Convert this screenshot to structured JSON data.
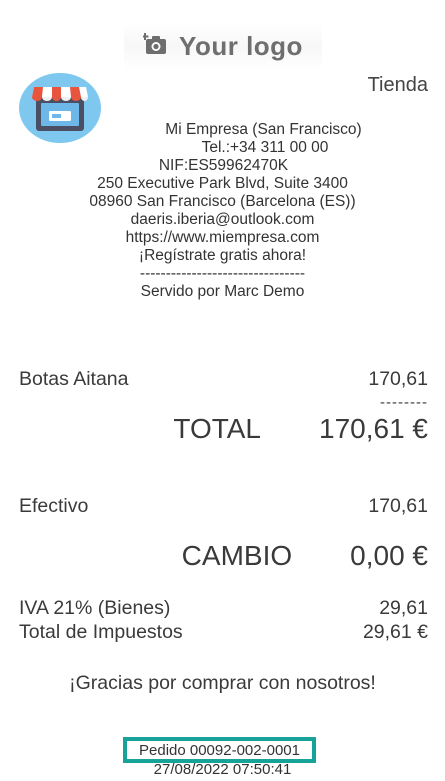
{
  "header": {
    "logo_text": "Your logo",
    "logo_icon": "camera-add-icon",
    "shop_icon": "storefront-icon",
    "store_label": "Tienda"
  },
  "company": {
    "name": "Mi Empresa (San Francisco)",
    "phone": "Tel.:+34 311 00 00",
    "vat": "NIF:ES59962470K",
    "address1": "250 Executive Park Blvd, Suite 3400",
    "address2": "08960 San Francisco (Barcelona (ES))",
    "email": "daeris.iberia@outlook.com",
    "website": "https://www.miempresa.com",
    "signup": "¡Regístrate gratis ahora!",
    "separator": "--------------------------------",
    "served_by": "Servido por Marc Demo"
  },
  "lines": [
    {
      "product": "Botas Aitana",
      "price": "170,61"
    }
  ],
  "subtotal_dashes": "--------",
  "total": {
    "label": "TOTAL",
    "amount": "170,61 €"
  },
  "payment": {
    "method": "Efectivo",
    "amount": "170,61"
  },
  "change": {
    "label": "CAMBIO",
    "amount": "0,00 €"
  },
  "taxes": [
    {
      "label": "IVA 21% (Bienes)",
      "amount": "29,61"
    },
    {
      "label": "Total de Impuestos",
      "amount": "29,61 €"
    }
  ],
  "footer": {
    "thanks": "¡Gracias por comprar con nosotros!",
    "order_ref": "Pedido 00092-002-0001",
    "order_date": "27/08/2022 07:50:41"
  },
  "colors": {
    "accent": "#17a29a",
    "awning": "#e8553f",
    "avatar_bg": "#7ec8ef"
  }
}
